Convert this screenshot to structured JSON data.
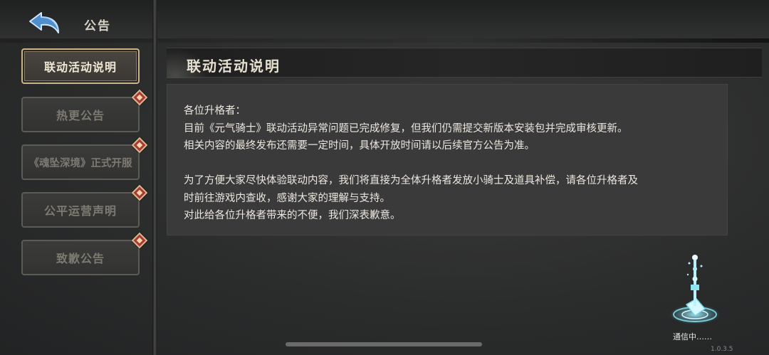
{
  "header": {
    "title": "公告",
    "back_icon": "back-arrow-icon"
  },
  "sidebar": {
    "items": [
      {
        "label": "联动活动说明",
        "active": true,
        "badge": false
      },
      {
        "label": "热更公告",
        "active": false,
        "badge": true
      },
      {
        "label": "《魂坠深境》正式开服",
        "active": false,
        "badge": true
      },
      {
        "label": "公平运营声明",
        "active": false,
        "badge": true
      },
      {
        "label": "致歉公告",
        "active": false,
        "badge": true
      }
    ]
  },
  "content": {
    "title": "联动活动说明",
    "lines": [
      "各位升格者：",
      "目前《元气骑士》联动活动异常问题已完成修复，但我们仍需提交新版本安装包并完成审核更新。",
      "相关内容的最终发布还需要一定时间，具体开放时间请以后续官方公告为准。",
      "",
      "为了方便大家尽快体验联动内容，我们将直接为全体升格者发放小骑士及道具补偿，请各位升格者及",
      "时前往游戏内查收，感谢大家的理解与支持。",
      "对此给各位升格者带来的不便，我们深表歉意。"
    ]
  },
  "status": {
    "text": "通信中……",
    "icon": "communication-beacon-icon",
    "version": "1.0.3.5"
  },
  "colors": {
    "accent_gold": "#c9b489",
    "badge_red": "#a8383a",
    "back_arrow_blue": "#6aa8e0"
  }
}
